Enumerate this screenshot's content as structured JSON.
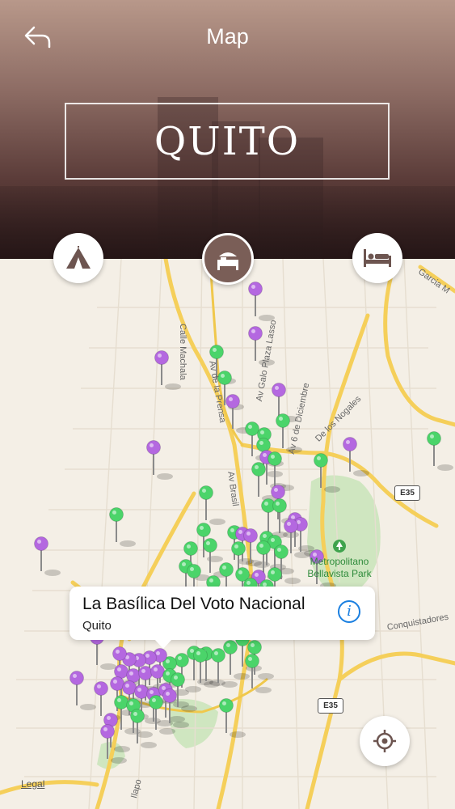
{
  "header": {
    "nav_title": "Map",
    "city_name": "QUITO",
    "back_icon": "back-arrow-icon"
  },
  "categories": [
    {
      "name": "attractions",
      "icon": "tent-icon",
      "active": false
    },
    {
      "name": "stays",
      "icon": "bed-icon",
      "active": true
    },
    {
      "name": "hotels",
      "icon": "bed-icon",
      "active": false
    }
  ],
  "map": {
    "road_labels": [
      "Calle Machala",
      "Av Galo Plaza Lasso",
      "Av de la Prensa",
      "Av 6 de Diciembre",
      "De los Nogales",
      "Av Brasil",
      "Garcia M",
      "Conquistadores",
      "Ilapo"
    ],
    "route_shields": [
      "E35",
      "E35"
    ],
    "park_label": "Metropolitano\nBellavista Park",
    "legal": "Legal",
    "pin_colors": {
      "purple": "#b468e0",
      "green": "#4bd46a"
    }
  },
  "callout": {
    "title": "La Basílica Del Voto Nacional",
    "subtitle": "Quito",
    "info_icon": "info-icon"
  },
  "locate_icon": "locate-icon"
}
